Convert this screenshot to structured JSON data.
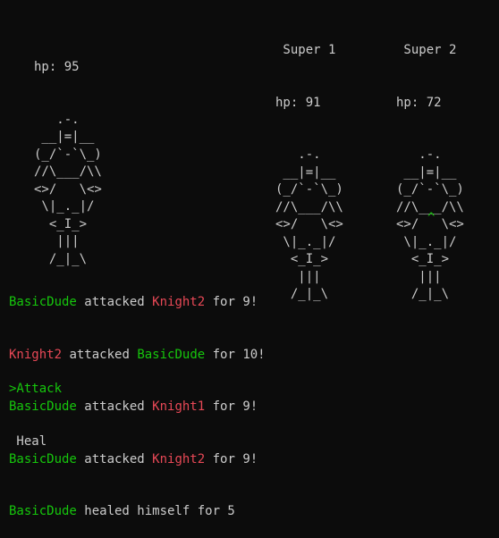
{
  "player": {
    "hp": "hp: 95",
    "art": "   .-.\n __|=|__\n(_/`-`\\_)\n//\\___/\\\\\n<>/   \\<>\n \\|_._|/\n  <_I_>\n   |||\n  /_|_\\"
  },
  "enemies": [
    {
      "name": " Super 1",
      "hp": "hp: 91",
      "art": "   .-.\n __|=|__\n(_/`-`\\_)\n//\\___/\\\\\n<>/   \\<>\n \\|_._|/\n  <_I_>\n   |||\n  /_|_\\"
    },
    {
      "name": " Super 2",
      "hp": "hp: 72",
      "art": "   .-.\n __|=|__\n(_/`-`\\_)\n//\\___/\\\\\n<>/   \\<>\n \\|_._|/\n  <_I_>\n   |||\n  /_|_\\"
    }
  ],
  "target_cursor": "^",
  "log": [
    {
      "actor": "BasicDude",
      "verb": " attacked ",
      "target": "Knight2",
      "tail": " for 9!"
    },
    {
      "actor": "Knight2",
      "verb": " attacked ",
      "target": "BasicDude",
      "tail": " for 10!"
    },
    {
      "actor": "BasicDude",
      "verb": " attacked ",
      "target": "Knight1",
      "tail": " for 9!"
    },
    {
      "actor": "BasicDude",
      "verb": " attacked ",
      "target": "Knight2",
      "tail": " for 9!"
    },
    {
      "actor": "BasicDude",
      "verb": " healed himself for 5",
      "target": "",
      "tail": ""
    }
  ],
  "menu": {
    "attack": ">Attack",
    "heal": " Heal"
  },
  "colors": {
    "background": "#0c0c0c",
    "text": "#cccccc",
    "player": "#16c60c",
    "enemy": "#e74856"
  }
}
